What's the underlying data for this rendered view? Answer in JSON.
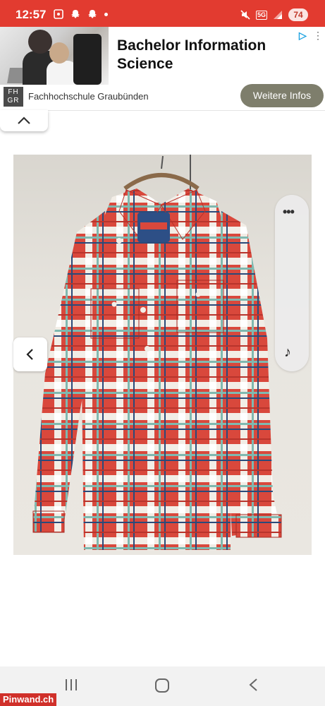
{
  "status_bar": {
    "time": "12:57",
    "network": "5G",
    "battery": "74",
    "accent_color": "#e23b30"
  },
  "ad": {
    "title": "Bachelor Information Science",
    "advertiser_logo": "FH GR",
    "advertiser": "Fachhochschule Graubünden",
    "cta": "Weitere Infos",
    "icons": [
      "adchoices-icon",
      "close-icon"
    ]
  },
  "viewer": {
    "icons": [
      "chevron-up-icon",
      "chevron-left-icon",
      "more-icon",
      "music-note-icon"
    ]
  },
  "nav": {
    "icons": [
      "recent-apps-icon",
      "home-icon",
      "back-icon"
    ]
  },
  "watermark": "Pinwand.ch"
}
